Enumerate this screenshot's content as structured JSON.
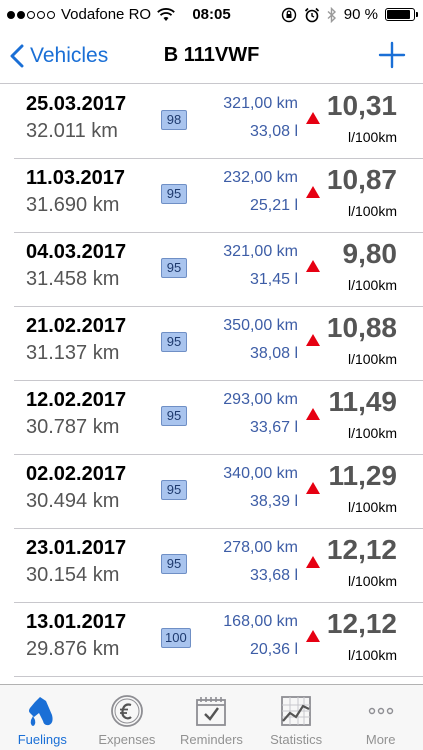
{
  "status_bar": {
    "carrier": "Vodafone RO",
    "time": "08:05",
    "battery": "90 %"
  },
  "nav": {
    "back_label": "Vehicles",
    "title": "B 111VWF"
  },
  "fuelings": [
    {
      "date": "25.03.2017",
      "odometer": "32.011 km",
      "fuel": "98",
      "distance": "321,00 km",
      "volume": "33,08 l",
      "consumption": "10,31",
      "unit": "l/100km"
    },
    {
      "date": "11.03.2017",
      "odometer": "31.690 km",
      "fuel": "95",
      "distance": "232,00 km",
      "volume": "25,21 l",
      "consumption": "10,87",
      "unit": "l/100km"
    },
    {
      "date": "04.03.2017",
      "odometer": "31.458 km",
      "fuel": "95",
      "distance": "321,00 km",
      "volume": "31,45 l",
      "consumption": "9,80",
      "unit": "l/100km"
    },
    {
      "date": "21.02.2017",
      "odometer": "31.137 km",
      "fuel": "95",
      "distance": "350,00 km",
      "volume": "38,08 l",
      "consumption": "10,88",
      "unit": "l/100km"
    },
    {
      "date": "12.02.2017",
      "odometer": "30.787 km",
      "fuel": "95",
      "distance": "293,00 km",
      "volume": "33,67 l",
      "consumption": "11,49",
      "unit": "l/100km"
    },
    {
      "date": "02.02.2017",
      "odometer": "30.494 km",
      "fuel": "95",
      "distance": "340,00 km",
      "volume": "38,39 l",
      "consumption": "11,29",
      "unit": "l/100km"
    },
    {
      "date": "23.01.2017",
      "odometer": "30.154 km",
      "fuel": "95",
      "distance": "278,00 km",
      "volume": "33,68 l",
      "consumption": "12,12",
      "unit": "l/100km"
    },
    {
      "date": "13.01.2017",
      "odometer": "29.876 km",
      "fuel": "100",
      "distance": "168,00 km",
      "volume": "20,36 l",
      "consumption": "12,12",
      "unit": "l/100km"
    }
  ],
  "tabs": [
    {
      "label": "Fuelings",
      "icon": "fuel-pump-icon"
    },
    {
      "label": "Expenses",
      "icon": "euro-coin-icon"
    },
    {
      "label": "Reminders",
      "icon": "calendar-check-icon"
    },
    {
      "label": "Statistics",
      "icon": "chart-icon"
    },
    {
      "label": "More",
      "icon": "more-dots-icon"
    }
  ],
  "colors": {
    "accent": "#1a6fd6",
    "trend_up": "#e60012",
    "badge_bg": "#a9c4ee"
  }
}
